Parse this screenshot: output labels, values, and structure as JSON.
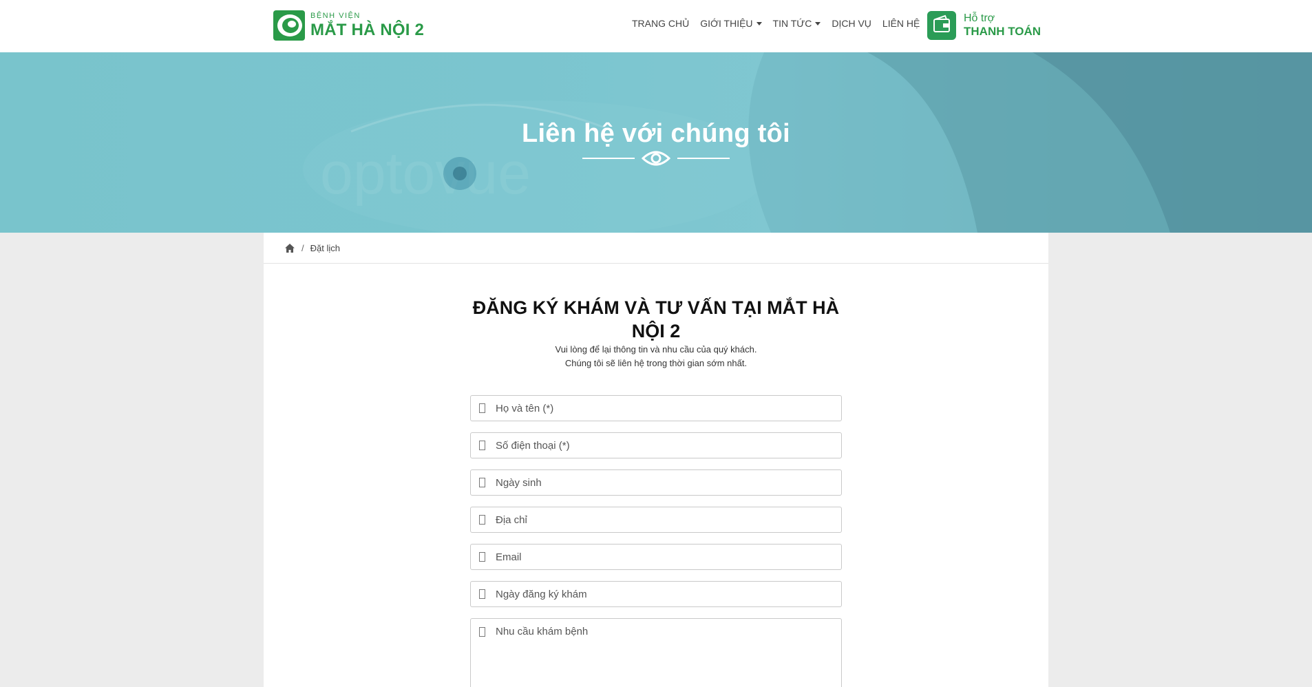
{
  "brand": {
    "line1": "BỆNH VIỆN",
    "line2": "MẮT HÀ NỘI 2",
    "color": "#2a9a48"
  },
  "nav": {
    "items": [
      {
        "label": "TRANG CHỦ",
        "dropdown": false
      },
      {
        "label": "GIỚI THIỆU",
        "dropdown": true
      },
      {
        "label": "TIN TỨC",
        "dropdown": true
      },
      {
        "label": "DỊCH VỤ",
        "dropdown": false
      },
      {
        "label": "LIÊN HỆ",
        "dropdown": false
      }
    ]
  },
  "payment": {
    "line1": "Hỗ trợ",
    "line2": "THANH TOÁN",
    "icon": "wallet-icon"
  },
  "banner": {
    "title": "Liên hệ với chúng tôi",
    "icon": "eye-icon"
  },
  "breadcrumb": {
    "home_icon": "home-icon",
    "separator": "/",
    "current": "Đặt lịch"
  },
  "form": {
    "title": "ĐĂNG KÝ KHÁM VÀ TƯ VẤN TẠI MẮT HÀ NỘI 2",
    "subtitle_line1": "Vui lòng để lại thông tin và nhu cầu của quý khách.",
    "subtitle_line2": "Chúng tôi sẽ liên hệ trong thời gian sớm nhất.",
    "fields": {
      "name": {
        "placeholder": "Họ và tên (*)",
        "value": ""
      },
      "phone": {
        "placeholder": "Số điện thoại (*)",
        "value": ""
      },
      "birthday": {
        "placeholder": "Ngày sinh",
        "value": ""
      },
      "address": {
        "placeholder": "Địa chỉ",
        "value": ""
      },
      "email": {
        "placeholder": "Email",
        "value": ""
      },
      "exam_date": {
        "placeholder": "Ngày đăng ký khám",
        "value": ""
      },
      "needs": {
        "placeholder": "Nhu cầu khám bệnh",
        "value": ""
      }
    }
  }
}
